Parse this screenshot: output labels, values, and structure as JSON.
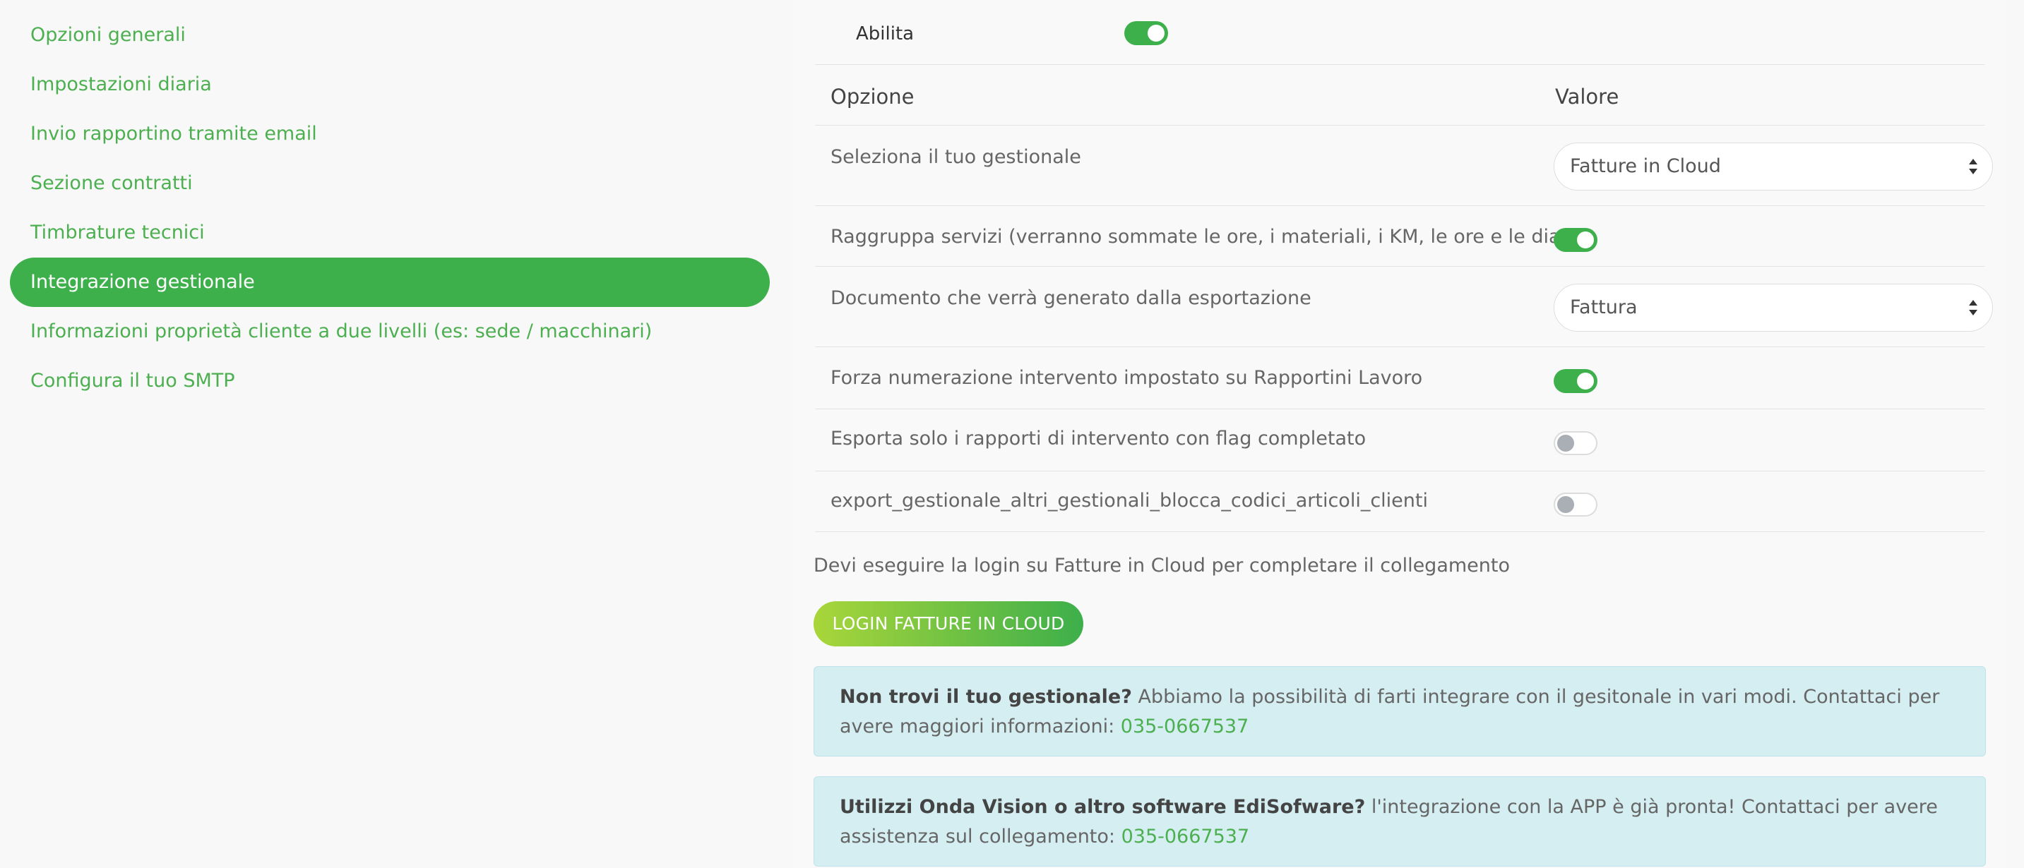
{
  "sidebar": {
    "items": [
      {
        "label": "Opzioni generali"
      },
      {
        "label": "Impostazioni diaria"
      },
      {
        "label": "Invio rapportino tramite email"
      },
      {
        "label": "Sezione contratti"
      },
      {
        "label": "Timbrature tecnici"
      },
      {
        "label": "Integrazione gestionale",
        "active": true
      },
      {
        "label": "Informazioni proprietà cliente a due livelli (es: sede / macchinari)"
      },
      {
        "label": "Configura il tuo SMTP"
      }
    ]
  },
  "main": {
    "enable": {
      "label": "Abilita",
      "on": true
    },
    "table": {
      "headers": {
        "option": "Opzione",
        "value": "Valore"
      },
      "rows": [
        {
          "label": "Seleziona il tuo gestionale",
          "type": "select",
          "value": "Fatture in Cloud"
        },
        {
          "label": "Raggruppa servizi (verranno sommate le ore, i materiali, i KM, le ore e le diarie)",
          "type": "toggle",
          "on": true
        },
        {
          "label": "Documento che verrà generato dalla esportazione",
          "type": "select",
          "value": "Fattura"
        },
        {
          "label": "Forza numerazione intervento impostato su Rapportini Lavoro",
          "type": "toggle",
          "on": true
        },
        {
          "label": "Esporta solo i rapporti di intervento con flag completato",
          "type": "toggle",
          "on": false
        },
        {
          "label": "export_gestionale_altri_gestionali_blocca_codici_articoli_clienti",
          "type": "toggle",
          "on": false
        }
      ]
    },
    "login_note": "Devi eseguire la login su Fatture in Cloud per completare il collegamento",
    "login_button": "LOGIN FATTURE IN CLOUD",
    "alerts": [
      {
        "bold": "Non trovi il tuo gestionale?",
        "text": " Abbiamo la possibilità di farti integrare con il gesitonale in vari modi. Contattaci per avere maggiori informazioni: ",
        "phone": "035-0667537"
      },
      {
        "bold": "Utilizzi Onda Vision o altro software EdiSofware?",
        "text": " l'integrazione con la APP è già pronta! Contattaci per avere assistenza sul collegamento: ",
        "phone": "035-0667537"
      }
    ]
  },
  "colors": {
    "accent": "#3daf4b",
    "link": "#4caf50",
    "alert_bg": "#d5eef2",
    "toggle_off_knob": "#a9afb5"
  }
}
